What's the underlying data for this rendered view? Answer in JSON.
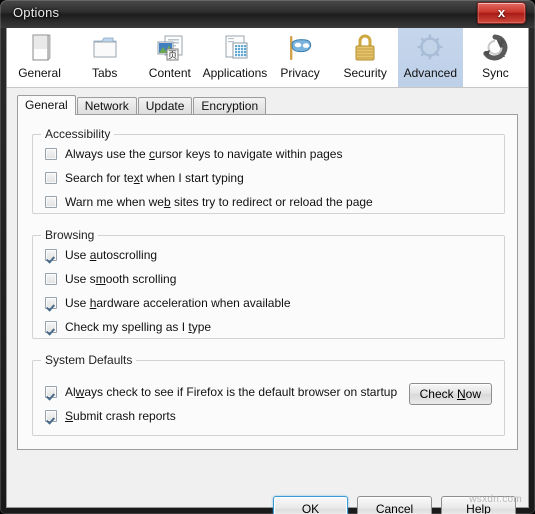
{
  "window": {
    "title": "Options",
    "close_label": "x",
    "watermark": "wsxdn.com"
  },
  "toolbar": {
    "items": [
      {
        "label": "General",
        "icon": "document-page-icon",
        "selected": false
      },
      {
        "label": "Tabs",
        "icon": "folder-tabs-icon",
        "selected": false
      },
      {
        "label": "Content",
        "icon": "content-page-icon",
        "selected": false
      },
      {
        "label": "Applications",
        "icon": "applications-icon",
        "selected": false
      },
      {
        "label": "Privacy",
        "icon": "mask-icon",
        "selected": false
      },
      {
        "label": "Security",
        "icon": "padlock-icon",
        "selected": false
      },
      {
        "label": "Advanced",
        "icon": "gear-icon",
        "selected": true
      },
      {
        "label": "Sync",
        "icon": "sync-arrows-icon",
        "selected": false
      }
    ]
  },
  "tabs": [
    {
      "label": "General",
      "selected": true
    },
    {
      "label": "Network",
      "selected": false
    },
    {
      "label": "Update",
      "selected": false
    },
    {
      "label": "Encryption",
      "selected": false
    }
  ],
  "groups": {
    "accessibility": {
      "title": "Accessibility",
      "options": [
        {
          "pre": "Always use the ",
          "key": "c",
          "post": "ursor keys to navigate within pages",
          "checked": false
        },
        {
          "pre": "Search for te",
          "key": "x",
          "post": "t when I start typing",
          "checked": false
        },
        {
          "pre": "Warn me when we",
          "key": "b",
          "post": " sites try to redirect or reload the page",
          "checked": false
        }
      ]
    },
    "browsing": {
      "title": "Browsing",
      "options": [
        {
          "pre": "Use ",
          "key": "a",
          "post": "utoscrolling",
          "checked": true
        },
        {
          "pre": "Use s",
          "key": "m",
          "post": "ooth scrolling",
          "checked": false
        },
        {
          "pre": "Use ",
          "key": "h",
          "post": "ardware acceleration when available",
          "checked": true
        },
        {
          "pre": "Check my spelling as I ",
          "key": "t",
          "post": "ype",
          "checked": true
        }
      ]
    },
    "system_defaults": {
      "title": "System Defaults",
      "options": [
        {
          "pre": "Al",
          "key": "w",
          "post": "ays check to see if Firefox is the default browser on startup",
          "checked": true
        },
        {
          "pre": "",
          "key": "S",
          "post": "ubmit crash reports",
          "checked": true
        }
      ],
      "check_now": {
        "pre": "Check ",
        "key": "N",
        "post": "ow"
      }
    }
  },
  "footer": {
    "buttons": [
      {
        "pre": "OK",
        "key": "",
        "post": "",
        "default": true,
        "name": "ok-button"
      },
      {
        "pre": "Cancel",
        "key": "",
        "post": "",
        "default": false,
        "name": "cancel-button"
      },
      {
        "pre": "",
        "key": "H",
        "post": "elp",
        "default": false,
        "name": "help-button"
      }
    ]
  },
  "colors": {
    "selected_tab_bg": "#c0d2ea",
    "panel_bg": "#fbfbfb",
    "dialog_bg": "#f0f0f0",
    "close_red": "#c9352b",
    "focus_blue": "#3c9ad6",
    "check_mark": "#4a6b8a"
  }
}
